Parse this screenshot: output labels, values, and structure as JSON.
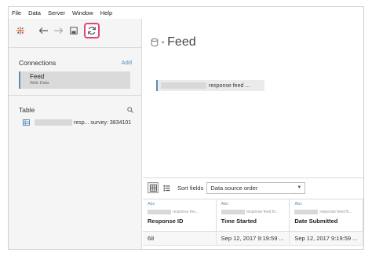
{
  "menu": [
    "File",
    "Data",
    "Server",
    "Window",
    "Help"
  ],
  "toolbar": {
    "icons": [
      "tableau-logo-icon",
      "back-arrow-icon",
      "forward-arrow-icon",
      "save-icon",
      "refresh-icon"
    ],
    "highlight_color": "#e0457b"
  },
  "connections": {
    "title": "Connections",
    "add_label": "Add",
    "items": [
      {
        "name": "Feed",
        "sub": "Web Data"
      }
    ]
  },
  "table": {
    "title": "Table",
    "items": [
      {
        "label": "resp... survey: 3834101"
      }
    ]
  },
  "datasource": {
    "name": "Feed"
  },
  "canvas": {
    "table_label": "response feed ..."
  },
  "grid": {
    "sort_label": "Sort fields",
    "sort_value": "Data source order",
    "columns": [
      {
        "type": "Abc",
        "source": "response fee...",
        "name": "Response ID"
      },
      {
        "type": "Abc",
        "source": "response feed fo...",
        "name": "Time Started"
      },
      {
        "type": "Abc",
        "source": "response feed fo...",
        "name": "Date Submitted"
      }
    ],
    "rows": [
      [
        "68",
        "Sep 12, 2017 9:19:59 ...",
        "Sep 12, 2017 9:19:59 ..."
      ]
    ]
  },
  "colors": {
    "accent": "#5b8db8",
    "highlight": "#e0457b"
  }
}
